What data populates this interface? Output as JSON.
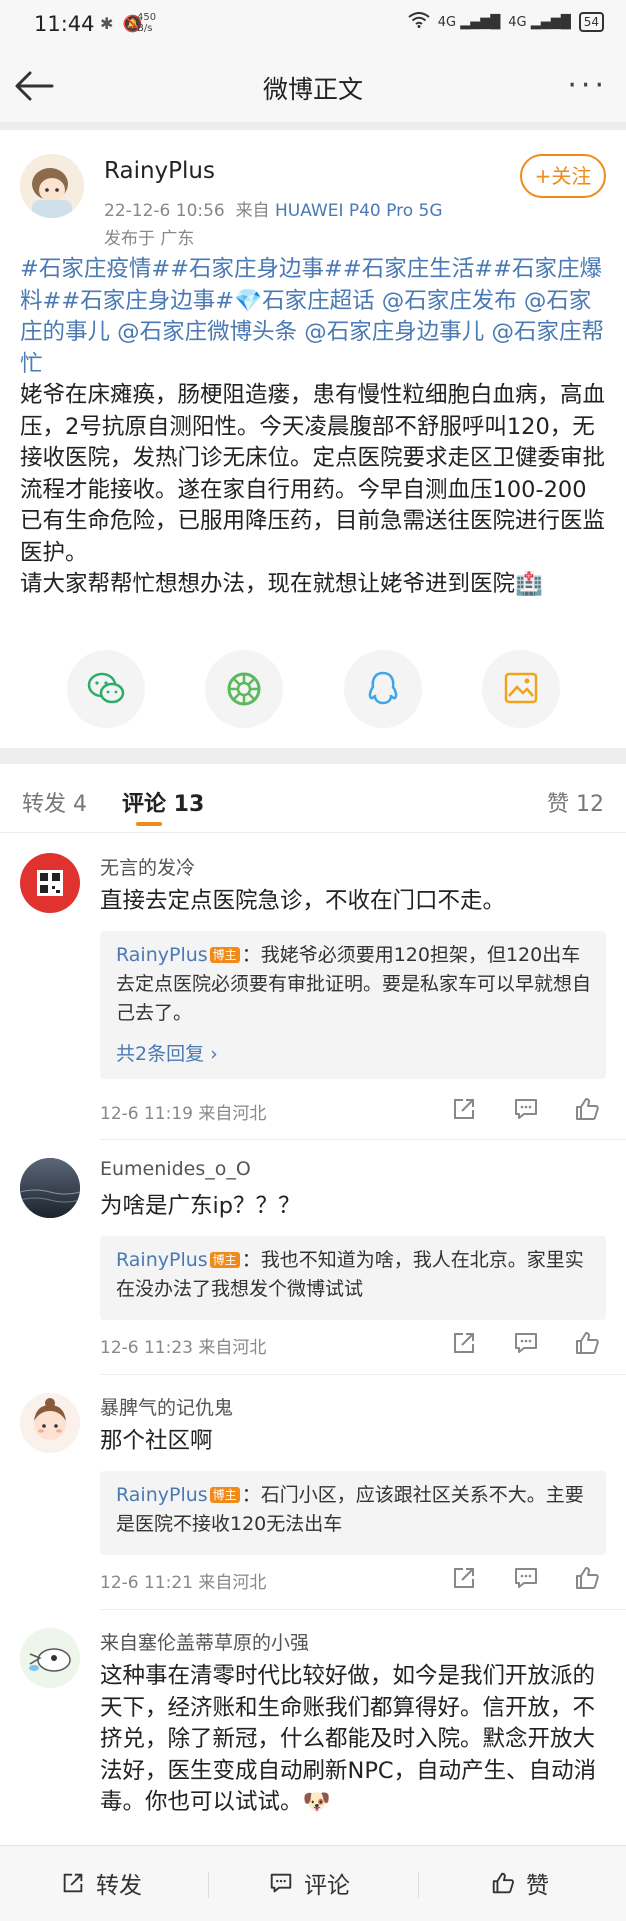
{
  "status_bar": {
    "time": "11:44",
    "net_speed_value": "450",
    "net_speed_unit": "B/s",
    "signal_1": "4G",
    "signal_2": "4G",
    "battery": "54"
  },
  "nav": {
    "title": "微博正文"
  },
  "post": {
    "user_name": "RainyPlus",
    "date": "22-12-6 10:56",
    "from_label": "来自",
    "device": "HUAWEI P40 Pro 5G",
    "location": "发布于 广东",
    "follow_label": "+关注",
    "tags_text": "#石家庄疫情##石家庄身边事##石家庄生活##石家庄爆料##石家庄身边事#💎石家庄超话 @石家庄发布 @石家庄的事儿 @石家庄微博头条 @石家庄身边事儿 @石家庄帮忙",
    "body_text": "姥爷在床瘫痪，肠梗阻造瘘，患有慢性粒细胞白血病，高血压，2号抗原自测阳性。今天凌晨腹部不舒服呼叫120，无接收医院，发热门诊无床位。定点医院要求走区卫健委审批流程才能接收。遂在家自行用药。今早自测血压100-200已有生命危险，已服用降压药，目前急需送往医院进行医监医护。",
    "body_text_2": "请大家帮帮忙想想办法，现在就想让姥爷进到医院🏥"
  },
  "tabs": {
    "repost": "转发 4",
    "comments": "评论 13",
    "likes": "赞 12"
  },
  "comments": [
    {
      "name": "无言的发冷",
      "text": "直接去定点医院急诊，不收在门口不走。",
      "reply_user": "RainyPlus",
      "reply_badge": "博主",
      "reply_text": "：我姥爷必须要用120担架，但120出车去定点医院必须要有审批证明。要是私家车可以早就想自己去了。",
      "reply_more": "共2条回复 ›",
      "meta": "12-6 11:19  来自河北"
    },
    {
      "name": "Eumenides_o_O",
      "text": "为啥是广东ip？？？",
      "reply_user": "RainyPlus",
      "reply_badge": "博主",
      "reply_text": "：我也不知道为啥，我人在北京。家里实在没办法了我想发个微博试试",
      "meta": "12-6 11:23  来自河北"
    },
    {
      "name": "暴脾气的记仇鬼",
      "text": "那个社区啊",
      "reply_user": "RainyPlus",
      "reply_badge": "博主",
      "reply_text": "：石门小区，应该跟社区关系不大。主要是医院不接收120无法出车",
      "meta": "12-6 11:21  来自河北"
    },
    {
      "name": "来自塞伦盖蒂草原的小强",
      "text": "这种事在清零时代比较好做，如今是我们开放派的天下，经济账和生命账我们都算得好。信开放，不挤兑，除了新冠，什么都能及时入院。默念开放大法好，医生变成自动刷新NPC，自动产生、自动消毒。你也可以试试。🐶"
    }
  ],
  "bottom_bar": {
    "repost": "转发",
    "comment": "评论",
    "like": "赞"
  },
  "colors": {
    "accent": "#f08a1a",
    "link": "#4a79b4",
    "wechat": "#2aae67",
    "moments": "#5cb85c",
    "qq": "#3ea6e8",
    "save": "#f0a21a"
  }
}
